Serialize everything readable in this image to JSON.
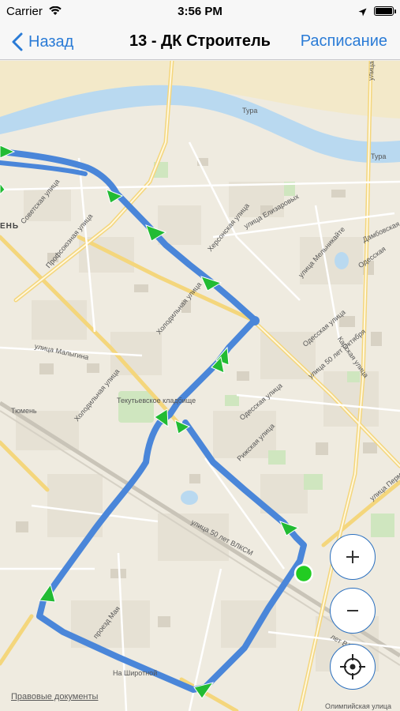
{
  "status_bar": {
    "carrier": "Carrier",
    "time": "3:56 PM",
    "battery_level": 1.0
  },
  "nav": {
    "back_label": "Назад",
    "title": "13 - ДК Строитель",
    "right_label": "Расписание"
  },
  "map": {
    "labels": {
      "river_1": "Тура",
      "river_2": "Тура",
      "district": "ЕНЬ",
      "sovetskaya": "Советская улица",
      "profsoyuznaya": "Профсоюзная улица",
      "kirova": "улица Кирова",
      "elizarovyh": "улица Елизаровых",
      "khersonskaya": "Херсонская улица",
      "respubliki": "улица Республики",
      "malygina": "улица Малыгина",
      "kholodilnaya": "Холодильная улица",
      "tekutyevskoe": "Текутьевское кладбище",
      "tyumen": "Тюмень",
      "odesskaya_1": "Одесская улица",
      "odesskaya_2": "Одесская улица",
      "karskaya": "Карская улица",
      "okt50": "улица 50 лет Октября",
      "rizhskaya": "Рижская улица",
      "vlksm_1": "улица 50 лет ВЛКСМ",
      "vlksm_2": "лет ВЛКСМ",
      "permyakova": "улица Пермякова",
      "melnikayte": "улица Мельникайте",
      "dambovskaya": "Дамбовская улица",
      "odesskaya_3": "Одесская",
      "shirotnaya": "На Широтной",
      "proezd_mayi": "проезд Мая",
      "olimpiyskaya": "Олимпийская улица",
      "malykina": "улица Малыгина",
      "tura_street": "Тура"
    },
    "route_color": "#4a86d9",
    "arrow_color": "#22bb33",
    "stop_color": "#22cc22"
  },
  "controls": {
    "zoom_in_symbol": "+",
    "zoom_out_symbol": "−"
  },
  "legal_link": "Правовые документы"
}
